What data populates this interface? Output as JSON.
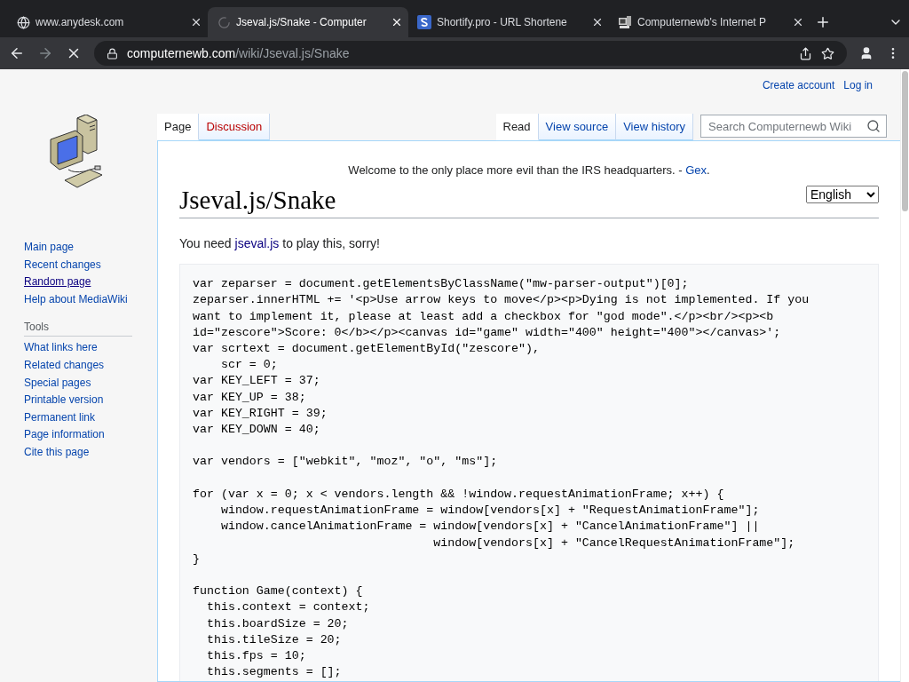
{
  "browser": {
    "tabs": [
      {
        "title": "www.anydesk.com",
        "kind": "globe",
        "selected": false
      },
      {
        "title": "Jseval.js/Snake - Computer",
        "kind": "loading",
        "selected": true
      },
      {
        "title": "Shortify.pro - URL Shortene",
        "kind": "logo",
        "selected": false
      },
      {
        "title": "Computernewb's Internet P",
        "kind": "computer",
        "selected": false
      }
    ],
    "address": {
      "host": "computernewb.com",
      "path": "/wiki/Jseval.js/Snake"
    },
    "loading": true
  },
  "personal_links": [
    "Create account",
    "Log in"
  ],
  "sidebar": {
    "nav": [
      {
        "label": "Main page",
        "hovered": false
      },
      {
        "label": "Recent changes",
        "hovered": false
      },
      {
        "label": "Random page",
        "hovered": true
      },
      {
        "label": "Help about MediaWiki",
        "hovered": false
      }
    ],
    "tools_heading": "Tools",
    "tools": [
      "What links here",
      "Related changes",
      "Special pages",
      "Printable version",
      "Permanent link",
      "Page information",
      "Cite this page"
    ]
  },
  "left_tabs": [
    {
      "label": "Page",
      "selected": true,
      "missing": false
    },
    {
      "label": "Discussion",
      "selected": false,
      "missing": true
    }
  ],
  "right_tabs": [
    {
      "label": "Read",
      "selected": true
    },
    {
      "label": "View source",
      "selected": false
    },
    {
      "label": "View history",
      "selected": false
    }
  ],
  "search": {
    "placeholder": "Search Computernewb Wiki"
  },
  "sitenotice": {
    "text": "Welcome to the only place more evil than the IRS headquarters. - ",
    "link": "Gex",
    "after": "."
  },
  "title": "Jseval.js/Snake",
  "language": "English",
  "intro": {
    "before": "You need ",
    "link": "jseval.js",
    "after": " to play this, sorry!"
  },
  "code": "var zeparser = document.getElementsByClassName(\"mw-parser-output\")[0];\nzeparser.innerHTML += '<p>Use arrow keys to move</p><p>Dying is not implemented. If you\nwant to implement it, please at least add a checkbox for \"god mode\".</p><br/><p><b\nid=\"zescore\">Score: 0</b></p><canvas id=\"game\" width=\"400\" height=\"400\"></canvas>';\nvar scrtext = document.getElementById(\"zescore\"),\n    scr = 0;\nvar KEY_LEFT = 37;\nvar KEY_UP = 38;\nvar KEY_RIGHT = 39;\nvar KEY_DOWN = 40;\n\nvar vendors = [\"webkit\", \"moz\", \"o\", \"ms\"];\n\nfor (var x = 0; x < vendors.length && !window.requestAnimationFrame; x++) {\n    window.requestAnimationFrame = window[vendors[x] + \"RequestAnimationFrame\"];\n    window.cancelAnimationFrame = window[vendors[x] + \"CancelAnimationFrame\"] ||\n                                  window[vendors[x] + \"CancelRequestAnimationFrame\"];\n}\n\nfunction Game(context) {\n  this.context = context;\n  this.boardSize = 20;\n  this.tileSize = 20;\n  this.fps = 10;\n  this.segments = [];"
}
